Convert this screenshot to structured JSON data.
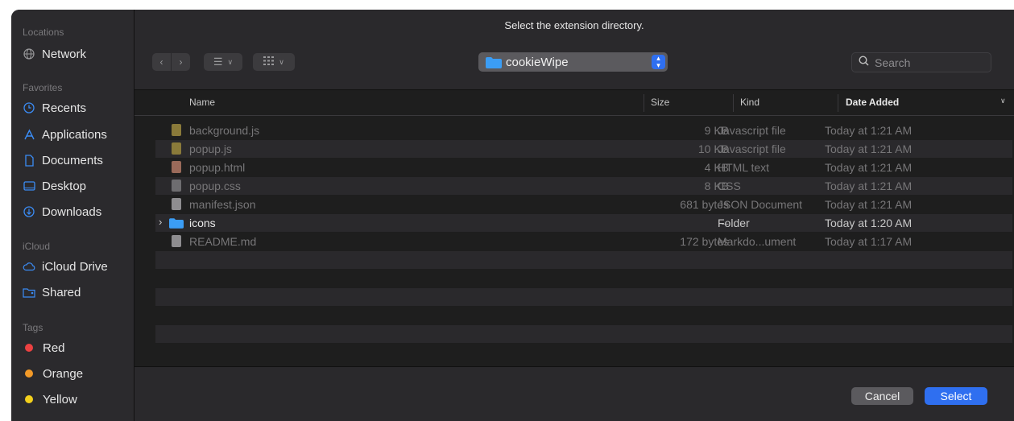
{
  "dialog": {
    "title": "Select the extension directory."
  },
  "sidebar": {
    "sections": [
      {
        "label": "Locations",
        "items": [
          {
            "label": "Network",
            "icon": "globe-icon"
          }
        ]
      },
      {
        "label": "Favorites",
        "items": [
          {
            "label": "Recents",
            "icon": "clock-icon"
          },
          {
            "label": "Applications",
            "icon": "applications-icon"
          },
          {
            "label": "Documents",
            "icon": "document-icon"
          },
          {
            "label": "Desktop",
            "icon": "desktop-icon"
          },
          {
            "label": "Downloads",
            "icon": "download-icon"
          }
        ]
      },
      {
        "label": "iCloud",
        "items": [
          {
            "label": "iCloud Drive",
            "icon": "cloud-icon"
          },
          {
            "label": "Shared",
            "icon": "shared-folder-icon"
          }
        ]
      },
      {
        "label": "Tags",
        "items": [
          {
            "label": "Red",
            "color": "#ec4141"
          },
          {
            "label": "Orange",
            "color": "#f39a28"
          },
          {
            "label": "Yellow",
            "color": "#f3d01c"
          }
        ]
      }
    ]
  },
  "toolbar": {
    "path": "cookieWipe",
    "search_placeholder": "Search"
  },
  "columns": {
    "name": "Name",
    "size": "Size",
    "kind": "Kind",
    "date": "Date Added"
  },
  "files": [
    {
      "name": "background.js",
      "size": "9 KB",
      "kind": "Javascript file",
      "date": "Today at 1:21 AM",
      "icon": "js-file-icon"
    },
    {
      "name": "popup.js",
      "size": "10 KB",
      "kind": "Javascript file",
      "date": "Today at 1:21 AM",
      "icon": "js-file-icon"
    },
    {
      "name": "popup.html",
      "size": "4 KB",
      "kind": "HTML text",
      "date": "Today at 1:21 AM",
      "icon": "html-file-icon"
    },
    {
      "name": "popup.css",
      "size": "8 KB",
      "kind": "CSS",
      "date": "Today at 1:21 AM",
      "icon": "css-file-icon"
    },
    {
      "name": "manifest.json",
      "size": "681 bytes",
      "kind": "JSON Document",
      "date": "Today at 1:21 AM",
      "icon": "json-file-icon"
    },
    {
      "name": "icons",
      "size": "--",
      "kind": "Folder",
      "date": "Today at 1:20 AM",
      "icon": "folder-icon"
    },
    {
      "name": "README.md",
      "size": "172 bytes",
      "kind": "Markdo...ument",
      "date": "Today at 1:17 AM",
      "icon": "text-file-icon"
    }
  ],
  "footer": {
    "cancel_label": "Cancel",
    "select_label": "Select"
  },
  "colors": {
    "accent": "#2f6ff0",
    "folder": "#3b9df5"
  }
}
